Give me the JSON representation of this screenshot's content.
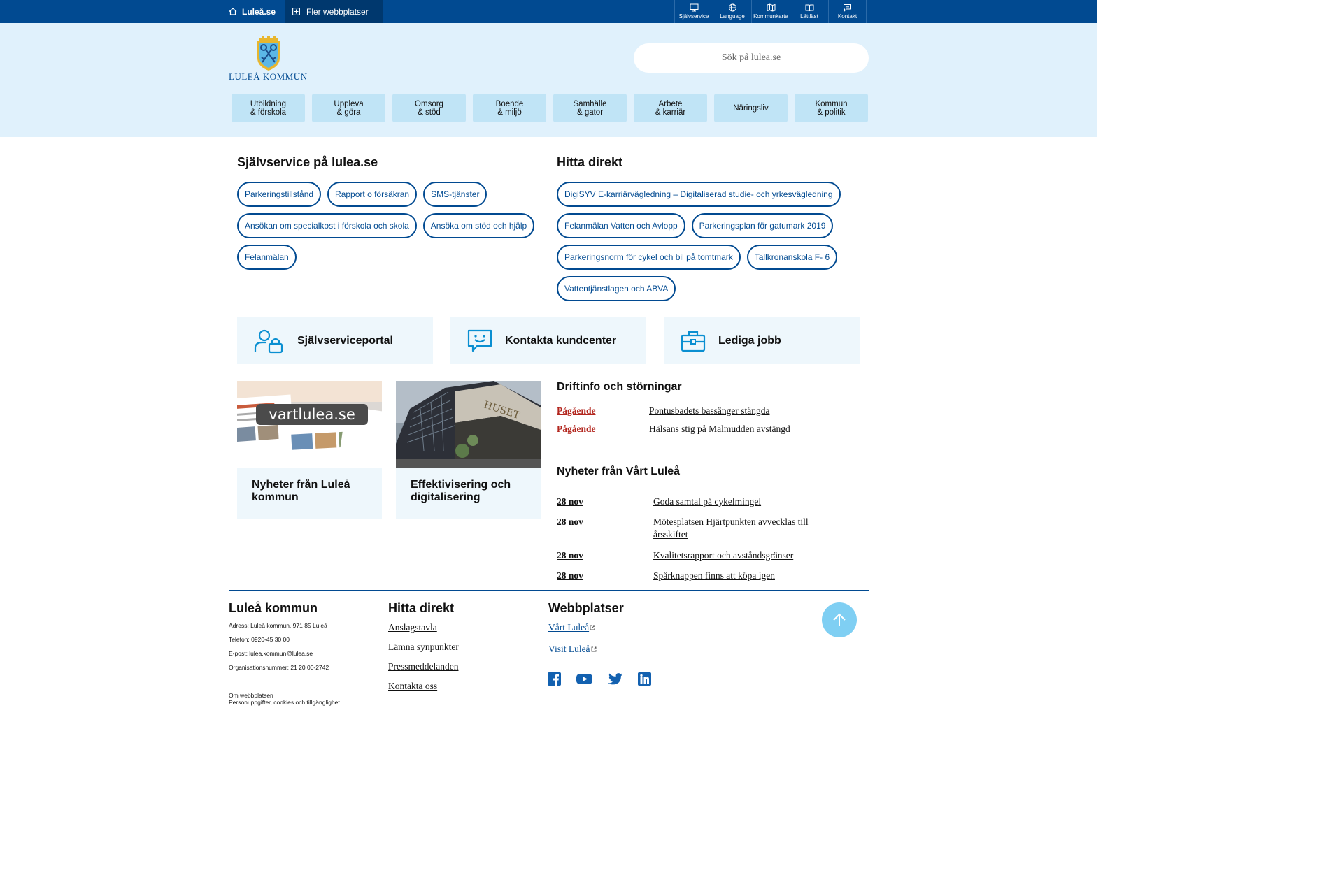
{
  "topbar": {
    "home_label": "Luleå.se",
    "more_label": "Fler webbplatser",
    "tools": [
      {
        "label": "Självservice",
        "icon": "monitor-icon"
      },
      {
        "label": "Language",
        "icon": "globe-icon"
      },
      {
        "label": "Kommunkarta",
        "icon": "map-icon"
      },
      {
        "label": "Lättläst",
        "icon": "book-icon"
      },
      {
        "label": "Kontakt",
        "icon": "chat-icon"
      }
    ]
  },
  "header": {
    "logo_text": "LULEÅ KOMMUN",
    "search_placeholder": "Sök på lulea.se"
  },
  "mainnav": [
    "Utbildning\n& förskola",
    "Uppleva\n& göra",
    "Omsorg\n& stöd",
    "Boende\n& miljö",
    "Samhälle\n& gator",
    "Arbete\n& karriär",
    "Näringsliv",
    "Kommun\n& politik"
  ],
  "selfservice": {
    "heading": "Självservice på lulea.se",
    "links": [
      "Parkeringstillstånd",
      "Rapport o försäkran",
      "SMS-tjänster",
      "Ansökan om specialkost i förskola och skola",
      "Ansöka om stöd och hjälp",
      "Felanmälan"
    ]
  },
  "direct": {
    "heading": "Hitta direkt",
    "links": [
      "DigiSYV E-karriärvägledning – Digitaliserad studie- och yrkesvägledning",
      "Felanmälan Vatten och Avlopp",
      "Parkeringsplan för gatumark 2019",
      "Parkeringsnorm för cykel och bil på tomtmark",
      "Tallkronanskola F- 6",
      "Vattentjänstlagen och ABVA"
    ]
  },
  "cards": [
    {
      "label": "Självserviceportal",
      "icon": "user-lock-icon"
    },
    {
      "label": "Kontakta kundcenter",
      "icon": "chat-smile-icon"
    },
    {
      "label": "Lediga jobb",
      "icon": "briefcase-icon"
    }
  ],
  "tiles": [
    {
      "title": "Nyheter från Luleå kommun",
      "image_text": "vartlulea.se"
    },
    {
      "title": "Effektivisering och digitalisering",
      "image_text": "HUSET"
    }
  ],
  "driftinfo": {
    "heading": "Driftinfo och störningar",
    "items": [
      {
        "status": "Pågående",
        "text": "Pontusbadets bassänger stängda"
      },
      {
        "status": "Pågående",
        "text": "Hälsans stig på Malmudden avstängd"
      }
    ]
  },
  "news": {
    "heading": "Nyheter från Vårt Luleå",
    "items": [
      {
        "date": "28 nov",
        "text": "Goda samtal på cykelmingel"
      },
      {
        "date": "28 nov",
        "text": "Mötesplatsen Hjärtpunkten avvecklas till årsskiftet"
      },
      {
        "date": "28 nov",
        "text": "Kvalitetsrapport och avståndsgränser"
      },
      {
        "date": "28 nov",
        "text": "Spårknappen finns att köpa igen"
      }
    ]
  },
  "footer": {
    "org_heading": "Luleå kommun",
    "address": "Adress: Luleå kommun, 971 85 Luleå",
    "phone": "Telefon: 0920-45 30 00",
    "email": "E-post: lulea.kommun@lulea.se",
    "orgnr": "Organisationsnummer: 21 20 00-2742",
    "about": "Om webbplatsen",
    "privacy": "Personuppgifter, cookies och tillgänglighet",
    "direct_heading": "Hitta direkt",
    "direct_links": [
      "Anslagstavla",
      "Lämna synpunkter",
      "Pressmeddelanden",
      "Kontakta oss"
    ],
    "sites_heading": "Webbplatser",
    "sites": [
      "Vårt Luleå",
      "Visit Luleå"
    ],
    "social": [
      "facebook-icon",
      "youtube-icon",
      "twitter-icon",
      "linkedin-icon"
    ]
  },
  "colors": {
    "brand": "#014a91",
    "header_bg": "#e0f1fc",
    "nav_bg": "#c0e4f6",
    "card_bg": "#eef7fc",
    "status_red": "#b3261e",
    "to_top": "#7fcff3"
  }
}
